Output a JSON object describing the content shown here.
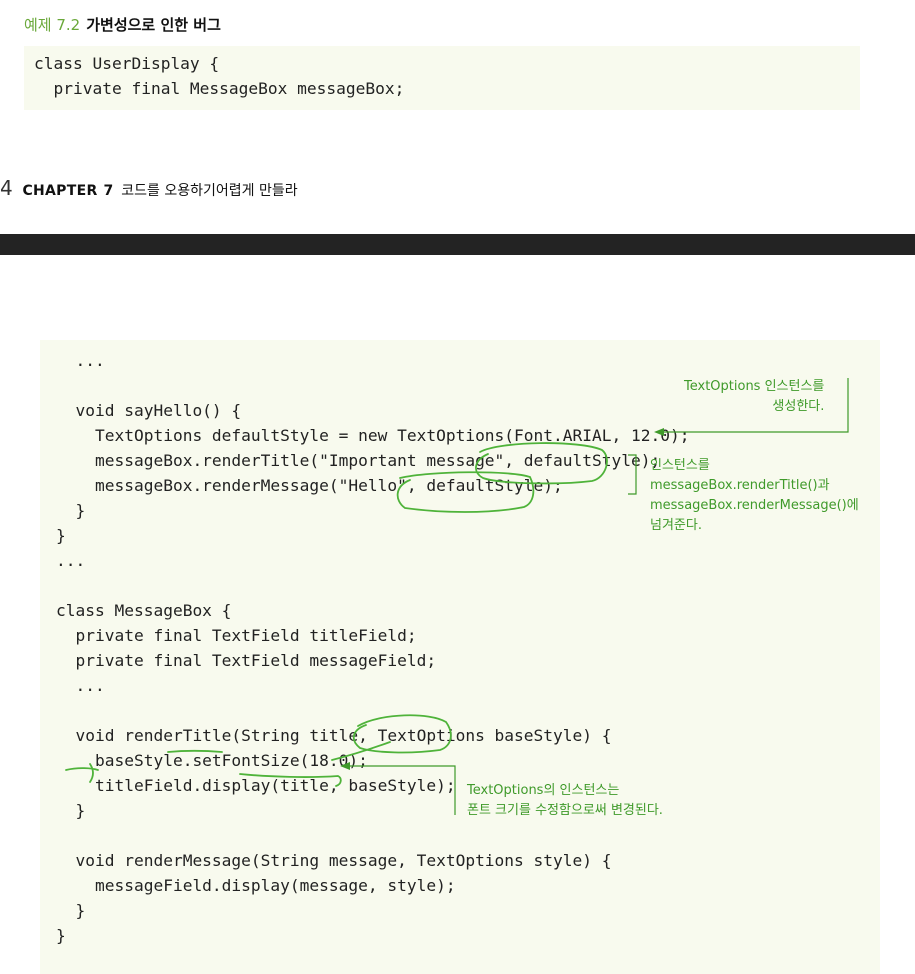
{
  "example": {
    "number": "예제 7.2",
    "title": "가변성으로 인한 버그"
  },
  "top_code": [
    "class UserDisplay {",
    "  private final MessageBox messageBox;"
  ],
  "footer": {
    "page_number": "4",
    "chapter_label": "CHAPTER",
    "chapter_number": "7",
    "chapter_title": "코드를 오용하기어렵게 만들라"
  },
  "main_code": [
    "  ...",
    "",
    "  void sayHello() {",
    "    TextOptions defaultStyle = new TextOptions(Font.ARIAL, 12.0);",
    "    messageBox.renderTitle(\"Important message\", defaultStyle);",
    "    messageBox.renderMessage(\"Hello\", defaultStyle);",
    "  }",
    "}",
    "...",
    "",
    "class MessageBox {",
    "  private final TextField titleField;",
    "  private final TextField messageField;",
    "  ...",
    "",
    "  void renderTitle(String title, TextOptions baseStyle) {",
    "    baseStyle.setFontSize(18.0);",
    "    titleField.display(title, baseStyle);",
    "  }",
    "",
    "  void renderMessage(String message, TextOptions style) {",
    "    messageField.display(message, style);",
    "  }",
    "}"
  ],
  "annotations": {
    "create": "TextOptions 인스턴스를\n생성한다.",
    "pass": "인스턴스를\nmessageBox.renderTitle()과\nmessageBox.renderMessage()에\n넘겨준다.",
    "modify": "TextOptions의 인스턴스는\n폰트 크기를 수정함으로써 변경된다."
  },
  "colors": {
    "accent_green": "#3f9a2a",
    "code_background": "#f8faee",
    "band": "#232323"
  }
}
